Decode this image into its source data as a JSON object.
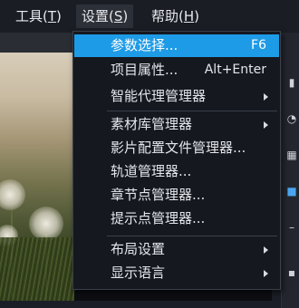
{
  "menubar": {
    "tools": {
      "label": "工具(",
      "key": "T",
      "close": ")"
    },
    "settings": {
      "label": "设置(",
      "key": "S",
      "close": ")"
    },
    "help": {
      "label": "帮助(",
      "key": "H",
      "close": ")"
    }
  },
  "dropdown": {
    "items": [
      {
        "label": "参数选择...",
        "shortcut": "F6",
        "submenu": false,
        "highlighted": true
      },
      {
        "label": "项目属性...",
        "shortcut": "Alt+Enter",
        "submenu": false,
        "highlighted": false
      },
      {
        "label": "智能代理管理器",
        "shortcut": "",
        "submenu": true,
        "highlighted": false
      },
      {
        "label": "素材库管理器",
        "shortcut": "",
        "submenu": true,
        "highlighted": false
      },
      {
        "label": "影片配置文件管理器...",
        "shortcut": "",
        "submenu": false,
        "highlighted": false
      },
      {
        "label": "轨道管理器...",
        "shortcut": "",
        "submenu": false,
        "highlighted": false
      },
      {
        "label": "章节点管理器...",
        "shortcut": "",
        "submenu": false,
        "highlighted": false
      },
      {
        "label": "提示点管理器...",
        "shortcut": "",
        "submenu": false,
        "highlighted": false
      },
      {
        "label": "布局设置",
        "shortcut": "",
        "submenu": true,
        "highlighted": false
      },
      {
        "label": "显示语言",
        "shortcut": "",
        "submenu": true,
        "highlighted": false
      }
    ]
  },
  "colors": {
    "highlight": "#1e9be6",
    "menu_bg": "#15181f",
    "active_menu_text": "#4aa6f0"
  }
}
